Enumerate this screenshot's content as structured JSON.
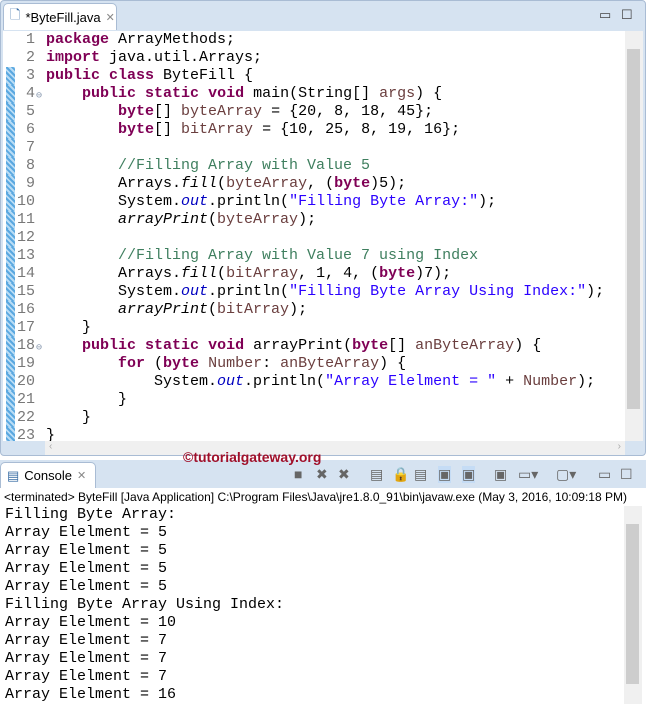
{
  "editor": {
    "tab_label": "*ByteFill.java",
    "lines": [
      [
        [
          "k",
          "package"
        ],
        [
          "p",
          " ArrayMethods;"
        ]
      ],
      [
        [
          "k",
          "import"
        ],
        [
          "p",
          " java.util.Arrays;"
        ]
      ],
      [
        [
          "k",
          "public"
        ],
        [
          "p",
          " "
        ],
        [
          "k",
          "class"
        ],
        [
          "p",
          " ByteFill {"
        ]
      ],
      [
        [
          "p",
          "    "
        ],
        [
          "k",
          "public"
        ],
        [
          "p",
          " "
        ],
        [
          "k",
          "static"
        ],
        [
          "p",
          " "
        ],
        [
          "k",
          "void"
        ],
        [
          "p",
          " main(String[] "
        ],
        [
          "v",
          "args"
        ],
        [
          "p",
          ") {"
        ]
      ],
      [
        [
          "p",
          "        "
        ],
        [
          "k",
          "byte"
        ],
        [
          "p",
          "[] "
        ],
        [
          "v",
          "byteArray"
        ],
        [
          "p",
          " = {20, 8, 18, 45};"
        ]
      ],
      [
        [
          "p",
          "        "
        ],
        [
          "k",
          "byte"
        ],
        [
          "p",
          "[] "
        ],
        [
          "v",
          "bitArray"
        ],
        [
          "p",
          " = {10, 25, 8, 19, 16};"
        ]
      ],
      [],
      [
        [
          "p",
          "        "
        ],
        [
          "c",
          "//Filling Array with Value 5"
        ]
      ],
      [
        [
          "p",
          "        Arrays."
        ],
        [
          "i",
          "fill"
        ],
        [
          "p",
          "("
        ],
        [
          "v",
          "byteArray"
        ],
        [
          "p",
          ", ("
        ],
        [
          "k",
          "byte"
        ],
        [
          "p",
          ")5);"
        ]
      ],
      [
        [
          "p",
          "        System."
        ],
        [
          "f",
          "out"
        ],
        [
          "p",
          ".println("
        ],
        [
          "s",
          "\"Filling Byte Array:\""
        ],
        [
          "p",
          ");"
        ]
      ],
      [
        [
          "p",
          "        "
        ],
        [
          "i",
          "arrayPrint"
        ],
        [
          "p",
          "("
        ],
        [
          "v",
          "byteArray"
        ],
        [
          "p",
          ");"
        ]
      ],
      [],
      [
        [
          "p",
          "        "
        ],
        [
          "c",
          "//Filling Array with Value 7 using Index"
        ]
      ],
      [
        [
          "p",
          "        Arrays."
        ],
        [
          "i",
          "fill"
        ],
        [
          "p",
          "("
        ],
        [
          "v",
          "bitArray"
        ],
        [
          "p",
          ", 1, 4, ("
        ],
        [
          "k",
          "byte"
        ],
        [
          "p",
          ")7);"
        ]
      ],
      [
        [
          "p",
          "        System."
        ],
        [
          "f",
          "out"
        ],
        [
          "p",
          ".println("
        ],
        [
          "s",
          "\"Filling Byte Array Using Index:\""
        ],
        [
          "p",
          ");"
        ]
      ],
      [
        [
          "p",
          "        "
        ],
        [
          "i",
          "arrayPrint"
        ],
        [
          "p",
          "("
        ],
        [
          "v",
          "bitArray"
        ],
        [
          "p",
          ");"
        ]
      ],
      [
        [
          "p",
          "    }"
        ]
      ],
      [
        [
          "p",
          "    "
        ],
        [
          "k",
          "public"
        ],
        [
          "p",
          " "
        ],
        [
          "k",
          "static"
        ],
        [
          "p",
          " "
        ],
        [
          "k",
          "void"
        ],
        [
          "p",
          " arrayPrint("
        ],
        [
          "k",
          "byte"
        ],
        [
          "p",
          "[] "
        ],
        [
          "v",
          "anByteArray"
        ],
        [
          "p",
          ") {"
        ]
      ],
      [
        [
          "p",
          "        "
        ],
        [
          "k",
          "for"
        ],
        [
          "p",
          " ("
        ],
        [
          "k",
          "byte"
        ],
        [
          "p",
          " "
        ],
        [
          "v",
          "Number"
        ],
        [
          "p",
          ": "
        ],
        [
          "v",
          "anByteArray"
        ],
        [
          "p",
          ") {"
        ]
      ],
      [
        [
          "p",
          "            System."
        ],
        [
          "f",
          "out"
        ],
        [
          "p",
          ".println("
        ],
        [
          "s",
          "\"Array Elelment = \""
        ],
        [
          "p",
          " + "
        ],
        [
          "v",
          "Number"
        ],
        [
          "p",
          ");"
        ]
      ],
      [
        [
          "p",
          "        }"
        ]
      ],
      [
        [
          "p",
          "    }"
        ]
      ],
      [
        [
          "p",
          "}"
        ]
      ]
    ]
  },
  "watermark": "©tutorialgateway.org",
  "console": {
    "tab_label": "Console",
    "status": "<terminated> ByteFill [Java Application] C:\\Program Files\\Java\\jre1.8.0_91\\bin\\javaw.exe (May 3, 2016, 10:09:18 PM)",
    "output": [
      "Filling Byte Array:",
      "Array Elelment = 5",
      "Array Elelment = 5",
      "Array Elelment = 5",
      "Array Elelment = 5",
      "Filling Byte Array Using Index:",
      "Array Elelment = 10",
      "Array Elelment = 7",
      "Array Elelment = 7",
      "Array Elelment = 7",
      "Array Elelment = 16"
    ]
  }
}
